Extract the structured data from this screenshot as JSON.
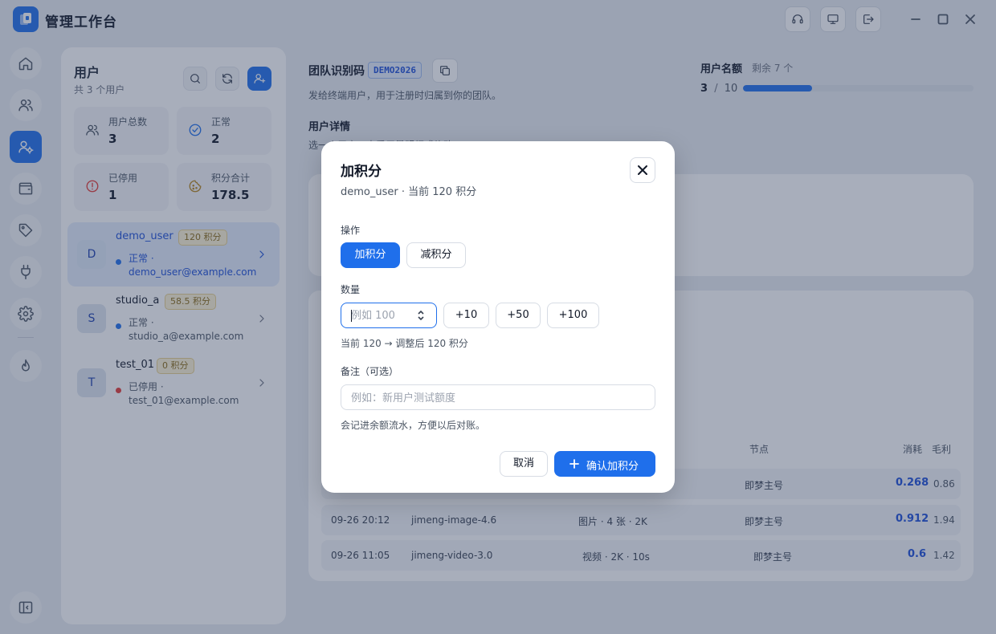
{
  "app": {
    "title": "管理工作台"
  },
  "users_panel": {
    "title": "用户",
    "subtitle": "共 3 个用户",
    "stats": [
      {
        "label": "用户总数",
        "value": "3",
        "icon": "users-icon"
      },
      {
        "label": "正常",
        "value": "2",
        "icon": "check-circle-icon"
      },
      {
        "label": "已停用",
        "value": "1",
        "icon": "alert-circle-icon"
      },
      {
        "label": "积分合计",
        "value": "178.5",
        "icon": "cookie-icon"
      }
    ],
    "users": [
      {
        "avatar": "D",
        "name": "demo_user",
        "badge": "120 积分",
        "status": "正常 ·",
        "email": "demo_user@example.com",
        "status_color": "#1f6feb"
      },
      {
        "avatar": "S",
        "name": "studio_a",
        "badge": "58.5 积分",
        "status": "正常 ·",
        "email": "studio_a@example.com",
        "status_color": "#1f6feb"
      },
      {
        "avatar": "T",
        "name": "test_01",
        "badge": "0 积分",
        "status": "已停用 ·",
        "email": "test_01@example.com",
        "status_color": "#e53935"
      }
    ]
  },
  "team": {
    "label": "团队识别码",
    "code": "DEMO2026",
    "desc": "发给终端用户，用于注册时归属到你的团队。"
  },
  "quota": {
    "label": "用户名额",
    "remaining": "剩余 7 个",
    "used": "3",
    "sep": "/",
    "total": "10",
    "fraction": 0.3
  },
  "details": {
    "label": "用户详情",
    "desc": "选一个用户，查看用量明细或修改"
  },
  "usage_table": {
    "headers": {
      "node": "节点",
      "cost": "消耗",
      "profit": "毛利"
    },
    "rows": [
      {
        "time": "",
        "model": "",
        "spec": "",
        "node": "即梦主号",
        "cost": "0.268",
        "profit": "0.86"
      },
      {
        "time": "09-26 20:12",
        "model": "jimeng-image-4.6",
        "spec": "图片 · 4 张 · 2K",
        "node": "即梦主号",
        "cost": "0.912",
        "profit": "1.94"
      },
      {
        "time": "09-26 11:05",
        "model": "jimeng-video-3.0",
        "spec": "视频 · 2K · 10s",
        "node": "即梦主号",
        "cost": "0.6",
        "profit": "1.42"
      }
    ]
  },
  "dialog": {
    "title": "加积分",
    "subtitle": "demo_user · 当前 120 积分",
    "op_label": "操作",
    "op_add": "加积分",
    "op_sub": "减积分",
    "amount_label": "数量",
    "amount_placeholder": "例如 100",
    "quick": [
      "+10",
      "+50",
      "+100"
    ],
    "preview": "当前 120 → 调整后 120 积分",
    "note_label": "备注（可选）",
    "note_placeholder": "例如：新用户测试额度",
    "note_hint": "会记进余额流水，方便以后对账。",
    "cancel": "取消",
    "confirm": "确认加积分"
  },
  "colors": {
    "accent": "#1f6feb",
    "badge_bg": "#fdf3d5",
    "disabled": "#e53935"
  }
}
